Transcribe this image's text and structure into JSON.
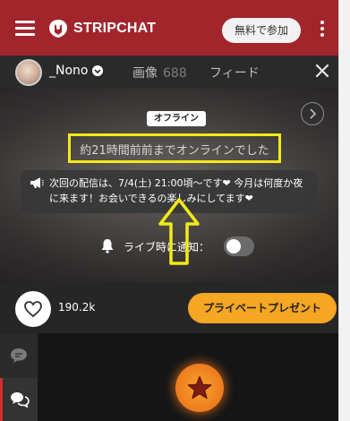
{
  "header": {
    "brand": "STRIPCHAT",
    "join_label": "無料で参加"
  },
  "profile_bar": {
    "username": "_Nono",
    "tabs": {
      "photos_label": "画像",
      "photos_count": "688",
      "feed_label": "フィード"
    }
  },
  "stream": {
    "offline_badge": "オフライン",
    "offline_message": "約21時間前前までオンラインでした",
    "schedule_text": "次回の配信は、7/4(土) 21:00頃〜です❤ 今月は何度か夜に来ます！お会いできるの楽しみにしてます❤",
    "notify_label": "ライブ時に通知：",
    "notify_enabled": false
  },
  "actions": {
    "like_count": "190.2k",
    "gift_label": "プライベートプレゼント"
  },
  "colors": {
    "header_bg": "#a2252c",
    "gift_button": "#f5a623",
    "highlight_box": "#f3ea16",
    "annotation_arrow": "#f3ea16",
    "active_side": "#d42c2c"
  },
  "icons": [
    "menu-icon",
    "brand-logo-icon",
    "kebab-menu-icon",
    "chevron-down-icon",
    "close-icon",
    "chevron-right-icon",
    "megaphone-icon",
    "bell-icon",
    "heart-icon",
    "chat-bubble-icon",
    "chat-bubbles-icon",
    "star-icon"
  ]
}
